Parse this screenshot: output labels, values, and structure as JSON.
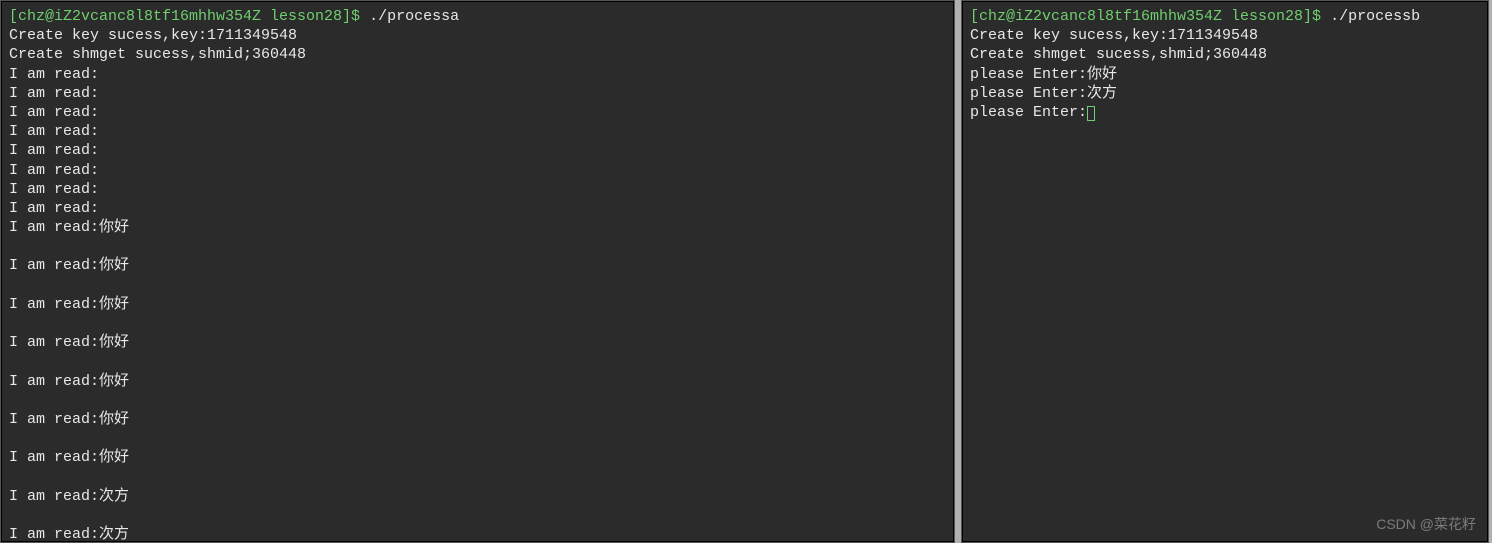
{
  "left": {
    "prompt_user_host": "[chz@iZ2vcanc8l8tf16mhhw354Z lesson28]$ ",
    "command": "./processa",
    "lines": [
      "Create key sucess,key:1711349548",
      "Create shmget sucess,shmid;360448",
      "I am read:",
      "I am read:",
      "I am read:",
      "I am read:",
      "I am read:",
      "I am read:",
      "I am read:",
      "I am read:",
      "I am read:你好",
      "",
      "I am read:你好",
      "",
      "I am read:你好",
      "",
      "I am read:你好",
      "",
      "I am read:你好",
      "",
      "I am read:你好",
      "",
      "I am read:你好",
      "",
      "I am read:次方",
      "",
      "I am read:次方"
    ]
  },
  "right": {
    "prompt_user_host": "[chz@iZ2vcanc8l8tf16mhhw354Z lesson28]$ ",
    "command": "./processb",
    "lines": [
      "Create key sucess,key:1711349548",
      "Create shmget sucess,shmid;360448",
      "please Enter:你好",
      "please Enter:次方"
    ],
    "input_prompt": "please Enter:"
  },
  "watermark": "CSDN @菜花籽"
}
